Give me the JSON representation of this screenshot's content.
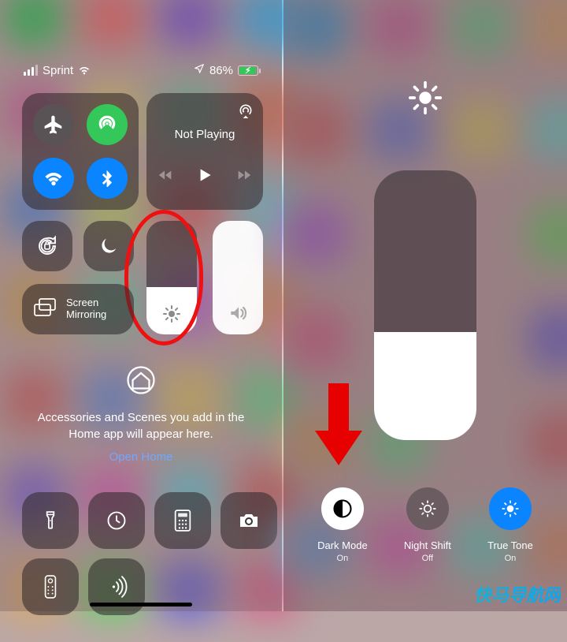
{
  "status": {
    "carrier": "Sprint",
    "battery_percent": "86%"
  },
  "music": {
    "now_playing": "Not Playing"
  },
  "screen_mirroring": {
    "label": "Screen\nMirroring"
  },
  "home": {
    "text": "Accessories and Scenes you add in the Home app will appear here.",
    "link": "Open Home"
  },
  "right": {
    "dark_mode": {
      "title": "Dark Mode",
      "state": "On"
    },
    "night_shift": {
      "title": "Night Shift",
      "state": "Off"
    },
    "true_tone": {
      "title": "True Tone",
      "state": "On"
    }
  },
  "watermark": "快马导航网",
  "colors": {
    "accent_blue": "#0a84ff",
    "accent_green": "#34c759",
    "highlight_red": "#e60000"
  }
}
